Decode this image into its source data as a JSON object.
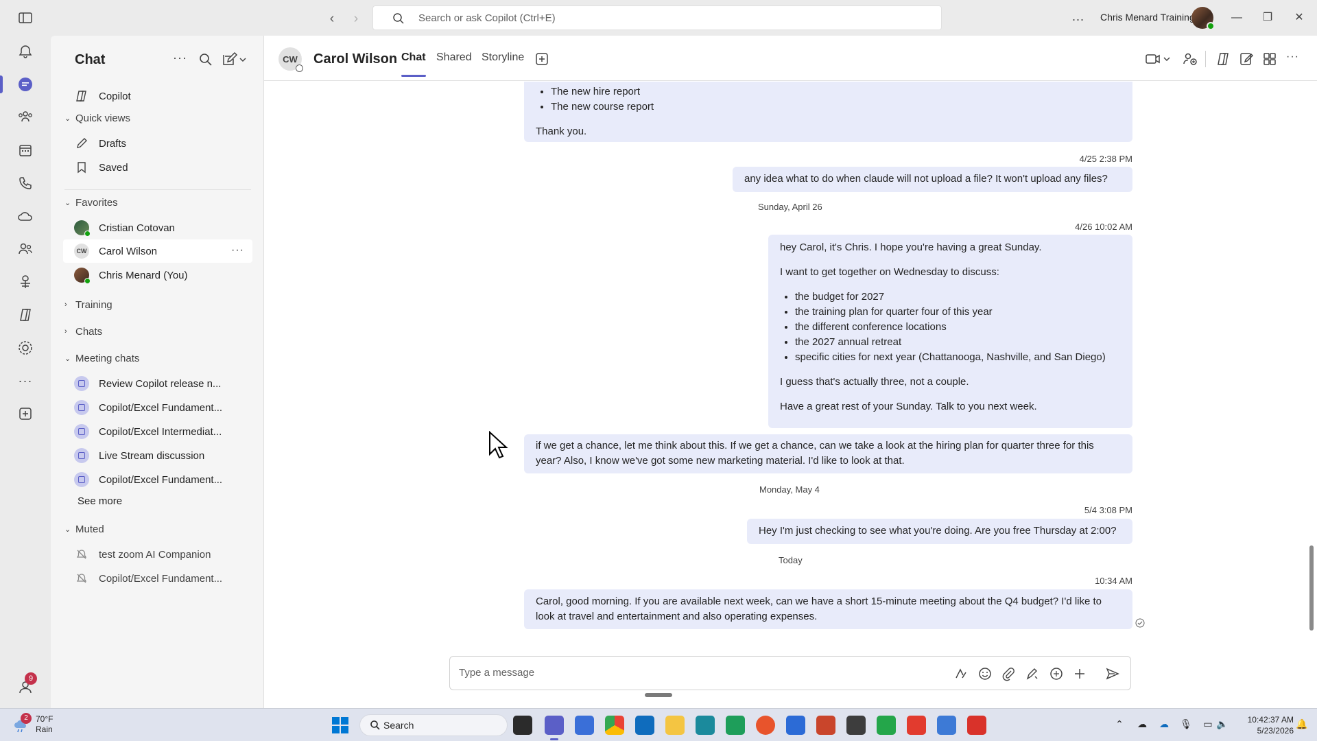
{
  "titlebar": {
    "search_placeholder": "Search or ask Copilot (Ctrl+E)",
    "account_name": "Chris Menard Training",
    "more": "..."
  },
  "rail": {
    "items": [
      "bell-icon",
      "chat-icon",
      "teams-icon",
      "calendar-icon",
      "calls-icon",
      "onedrive-icon",
      "people-icon",
      "viva-icon",
      "copilot-icon",
      "admin-icon",
      "more-icon",
      "add-apps-icon"
    ],
    "help_badge": "9"
  },
  "sidebar": {
    "title": "Chat",
    "copilot": "Copilot",
    "quick_views": "Quick views",
    "drafts": "Drafts",
    "saved": "Saved",
    "favorites": "Favorites",
    "fav_items": [
      "Cristian Cotovan",
      "Carol Wilson",
      "Chris Menard (You)"
    ],
    "carol_initials": "CW",
    "training": "Training",
    "chats": "Chats",
    "meeting_chats": "Meeting chats",
    "meetings": [
      "Review Copilot release n...",
      "Copilot/Excel Fundament...",
      "Copilot/Excel Intermediat...",
      "Live Stream discussion",
      "Copilot/Excel Fundament..."
    ],
    "see_more": "See more",
    "muted": "Muted",
    "muted_items": [
      "test zoom AI Companion",
      "Copilot/Excel Fundament..."
    ]
  },
  "header": {
    "initials": "CW",
    "name": "Carol Wilson",
    "tabs": [
      "Chat",
      "Shared",
      "Storyline"
    ]
  },
  "thread": {
    "msg1": {
      "bullets": [
        "The new hire report",
        "The new course report"
      ],
      "closing": "Thank you."
    },
    "stamp2": "4/25 2:38 PM",
    "msg2": "any idea what to do when claude will not upload a file? It won't upload any files?",
    "day1": "Sunday, April 26",
    "stamp3": "4/26 10:02 AM",
    "msg3": {
      "greeting": "hey Carol, it's Chris. I hope you're having a great Sunday.",
      "intro": "I want to get together on Wednesday to discuss:",
      "bullets": [
        "the budget for 2027",
        "the training plan for quarter four of this year",
        "the different conference locations",
        "the 2027 annual retreat",
        "specific cities for next year (Chattanooga, Nashville, and San Diego)"
      ],
      "note": "I guess that's actually three, not a couple.",
      "signoff": "Have a great rest of your Sunday. Talk to you next week."
    },
    "msg4": "if we get a chance, let me think about this. If we get a chance, can we take a look at the hiring plan for quarter three for this year? Also, I know we've got some new marketing material. I'd like to look at that.",
    "day2": "Monday, May 4",
    "stamp5": "5/4 3:08 PM",
    "msg5": "Hey I'm just checking to see what you're doing. Are you free Thursday at 2:00?",
    "day3": "Today",
    "stamp6": "10:34 AM",
    "msg6": "Carol, good morning. If you are available next week, can we have a short 15-minute meeting about the Q4 budget? I'd like to look at travel and entertainment and also operating expenses."
  },
  "composer": {
    "placeholder": "Type a message"
  },
  "taskbar": {
    "weather_badge": "2",
    "temperature": "70°F",
    "condition": "Rain",
    "search": "Search",
    "time": "10:42:37 AM",
    "date": "5/23/2026"
  },
  "colors": {
    "accent": "#5b5fc7",
    "bubble": "#e8ebfa",
    "presence": "#13a10e",
    "badge": "#c4314b"
  }
}
